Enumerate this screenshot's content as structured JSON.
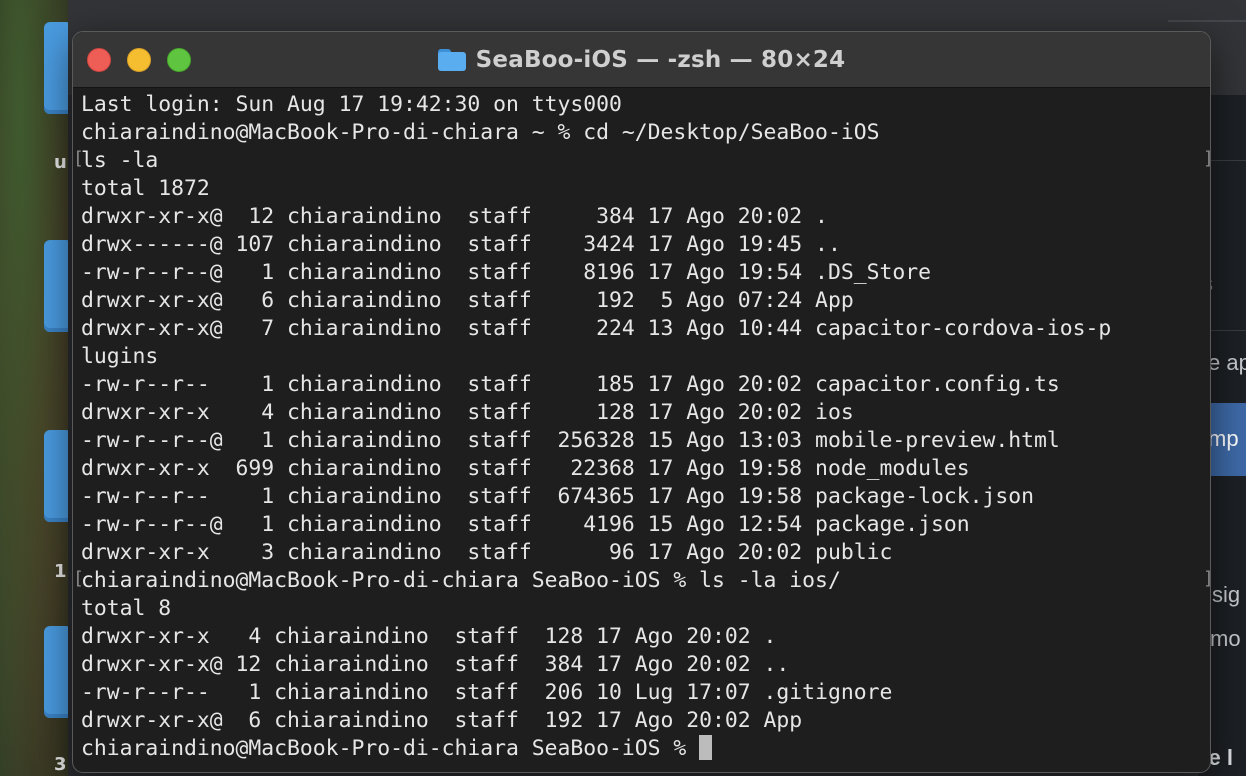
{
  "window": {
    "title": "SeaBoo-iOS — -zsh — 80×24"
  },
  "background_app": {
    "fragments": [
      "s",
      "e ap",
      "mp",
      "sig",
      "mo",
      "re l"
    ]
  },
  "desktop": {
    "labels": [
      "u",
      "1",
      "3"
    ]
  },
  "terminal": {
    "lines": [
      {
        "text": "Last login: Sun Aug 17 19:42:30 on ttys000"
      },
      {
        "text": "chiaraindino@MacBook-Pro-di-chiara ~ % cd ~/Desktop/SeaBoo-iOS"
      },
      {
        "text": "ls -la",
        "mark": true
      },
      {
        "text": "total 1872"
      },
      {
        "text": "drwxr-xr-x@  12 chiaraindino  staff     384 17 Ago 20:02 ."
      },
      {
        "text": "drwx------@ 107 chiaraindino  staff    3424 17 Ago 19:45 .."
      },
      {
        "text": "-rw-r--r--@   1 chiaraindino  staff    8196 17 Ago 19:54 .DS_Store"
      },
      {
        "text": "drwxr-xr-x@   6 chiaraindino  staff     192  5 Ago 07:24 App"
      },
      {
        "text": "drwxr-xr-x@   7 chiaraindino  staff     224 13 Ago 10:44 capacitor-cordova-ios-p"
      },
      {
        "text": "lugins"
      },
      {
        "text": "-rw-r--r--    1 chiaraindino  staff     185 17 Ago 20:02 capacitor.config.ts"
      },
      {
        "text": "drwxr-xr-x    4 chiaraindino  staff     128 17 Ago 20:02 ios"
      },
      {
        "text": "-rw-r--r--@   1 chiaraindino  staff  256328 15 Ago 13:03 mobile-preview.html"
      },
      {
        "text": "drwxr-xr-x  699 chiaraindino  staff   22368 17 Ago 19:58 node_modules"
      },
      {
        "text": "-rw-r--r--    1 chiaraindino  staff  674365 17 Ago 19:58 package-lock.json"
      },
      {
        "text": "-rw-r--r--@   1 chiaraindino  staff    4196 15 Ago 12:54 package.json"
      },
      {
        "text": "drwxr-xr-x    3 chiaraindino  staff      96 17 Ago 20:02 public"
      },
      {
        "text": "chiaraindino@MacBook-Pro-di-chiara SeaBoo-iOS % ls -la ios/",
        "mark": true
      },
      {
        "text": "total 8"
      },
      {
        "text": "drwxr-xr-x   4 chiaraindino  staff  128 17 Ago 20:02 ."
      },
      {
        "text": "drwxr-xr-x@ 12 chiaraindino  staff  384 17 Ago 20:02 .."
      },
      {
        "text": "-rw-r--r--   1 chiaraindino  staff  206 10 Lug 17:07 .gitignore"
      },
      {
        "text": "drwxr-xr-x@  6 chiaraindino  staff  192 17 Ago 20:02 App"
      },
      {
        "text": "chiaraindino@MacBook-Pro-di-chiara SeaBoo-iOS % ",
        "cursor": true
      }
    ],
    "colors": {
      "background": "#1e1e1e",
      "text": "#e6e6e6",
      "cursor": "#bcbcbc"
    }
  }
}
